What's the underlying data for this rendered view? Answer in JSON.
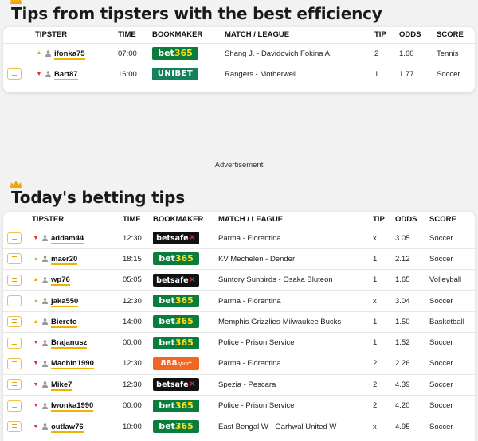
{
  "section1": {
    "title": "Tips from tipsters with the best efficiency",
    "columns": [
      "TIPSTER",
      "TIME",
      "BOOKMAKER",
      "MATCH / LEAGUE",
      "TIP",
      "ODDS",
      "SCORE"
    ],
    "rows": [
      {
        "tipster": "ifonka75",
        "time": "07:00",
        "bookmaker": "bet365",
        "match": "Shang J. - Davidovich Fokina A.",
        "tip": "2",
        "odds": "1.60",
        "score": "Tennis",
        "trend": "up",
        "star": false
      },
      {
        "tipster": "Bart87",
        "time": "16:00",
        "bookmaker": "unibet",
        "match": "Rangers - Motherwell",
        "tip": "1",
        "odds": "1.77",
        "score": "Soccer",
        "trend": "down",
        "star": true
      }
    ]
  },
  "advertisement_label": "Advertisement",
  "section2": {
    "title": "Today's betting tips",
    "columns": [
      "TIPSTER",
      "TIME",
      "BOOKMAKER",
      "MATCH / LEAGUE",
      "TIP",
      "ODDS",
      "SCORE"
    ],
    "rows": [
      {
        "tipster": "addam44",
        "time": "12:30",
        "bookmaker": "betsafe",
        "match": "Parma - Fiorentina",
        "tip": "x",
        "odds": "3.05",
        "score": "Soccer",
        "trend": "down"
      },
      {
        "tipster": "maer20",
        "time": "18:15",
        "bookmaker": "bet365",
        "match": "KV Mechelen - Dender",
        "tip": "1",
        "odds": "2.12",
        "score": "Soccer",
        "trend": "up"
      },
      {
        "tipster": "wp76",
        "time": "05:05",
        "bookmaker": "betsafe",
        "match": "Suntory Sunbirds - Osaka Bluteon",
        "tip": "1",
        "odds": "1.65",
        "score": "Volleyball",
        "trend": "up"
      },
      {
        "tipster": "jaka550",
        "time": "12:30",
        "bookmaker": "bet365",
        "match": "Parma - Fiorentina",
        "tip": "x",
        "odds": "3.04",
        "score": "Soccer",
        "trend": "up"
      },
      {
        "tipster": "Biereto",
        "time": "14:00",
        "bookmaker": "bet365",
        "match": "Memphis Grizzlies-Milwaukee Bucks",
        "tip": "1",
        "odds": "1.50",
        "score": "Basketball",
        "trend": "up"
      },
      {
        "tipster": "Brajanusz",
        "time": "00:00",
        "bookmaker": "bet365",
        "match": "Police - Prison Service",
        "tip": "1",
        "odds": "1.52",
        "score": "Soccer",
        "trend": "down"
      },
      {
        "tipster": "Machin1990",
        "time": "12:30",
        "bookmaker": "888sport",
        "match": "Parma - Fiorentina",
        "tip": "2",
        "odds": "2.26",
        "score": "Soccer",
        "trend": "down"
      },
      {
        "tipster": "Mike7",
        "time": "12:30",
        "bookmaker": "betsafe",
        "match": "Spezia - Pescara",
        "tip": "2",
        "odds": "4.39",
        "score": "Soccer",
        "trend": "down"
      },
      {
        "tipster": "Iwonka1990",
        "time": "00:00",
        "bookmaker": "bet365",
        "match": "Police - Prison Service",
        "tip": "2",
        "odds": "4.20",
        "score": "Soccer",
        "trend": "down"
      },
      {
        "tipster": "outlaw76",
        "time": "10:00",
        "bookmaker": "bet365",
        "match": "East Bengal W - Garhwal United W",
        "tip": "x",
        "odds": "4.95",
        "score": "Soccer",
        "trend": "down"
      }
    ]
  },
  "bookmaker_logos": {
    "bet365": {
      "a": "bet",
      "b": "365"
    },
    "unibet": {
      "a": "UNIBET"
    },
    "betsafe": {
      "a": "betsafe",
      "b": "✕"
    },
    "888sport": {
      "a": "888",
      "b": "sport"
    }
  },
  "colors": {
    "accent": "#f0b400",
    "bet365": "#0a7d3c",
    "unibet": "#14805e",
    "betsafe": "#111111",
    "888sport": "#f26522",
    "down_arrow": "#e03030"
  },
  "icons": {
    "crown": "crown-icon",
    "person": "person-icon",
    "favorite": "favorite-toggle-icon"
  }
}
